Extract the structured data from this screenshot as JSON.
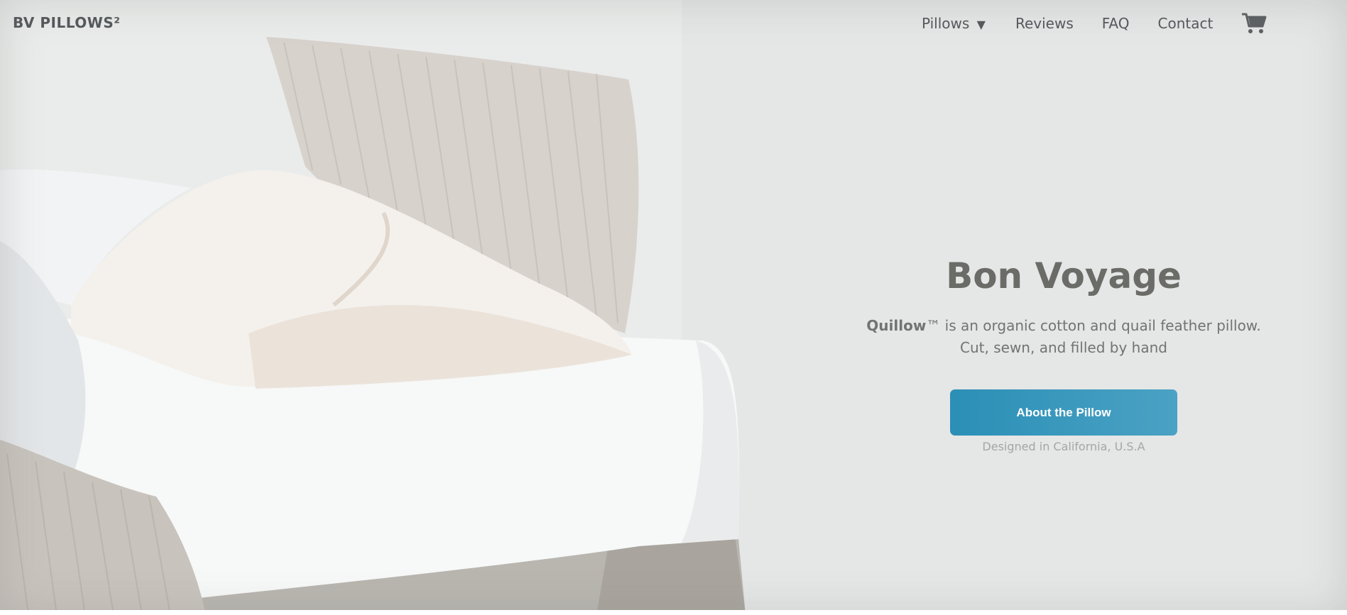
{
  "header": {
    "brand": "BV PILLOWS²",
    "nav": {
      "pillows": "Pillows",
      "pillows_caret": "▼",
      "reviews": "Reviews",
      "faq": "FAQ",
      "contact": "Contact"
    },
    "cart_icon": "shopping-cart-icon"
  },
  "hero": {
    "title": "Bon Voyage",
    "desc_brand": "Quillow",
    "desc_rest": "™ is an organic cotton and quail feather pillow.",
    "desc_line2": "Cut, sewn, and filled by hand",
    "cta_label": "About the Pillow",
    "footnote": "Designed in California, U.S.A"
  },
  "colors": {
    "cta": "#2b8fb6",
    "text": "#55595c"
  }
}
